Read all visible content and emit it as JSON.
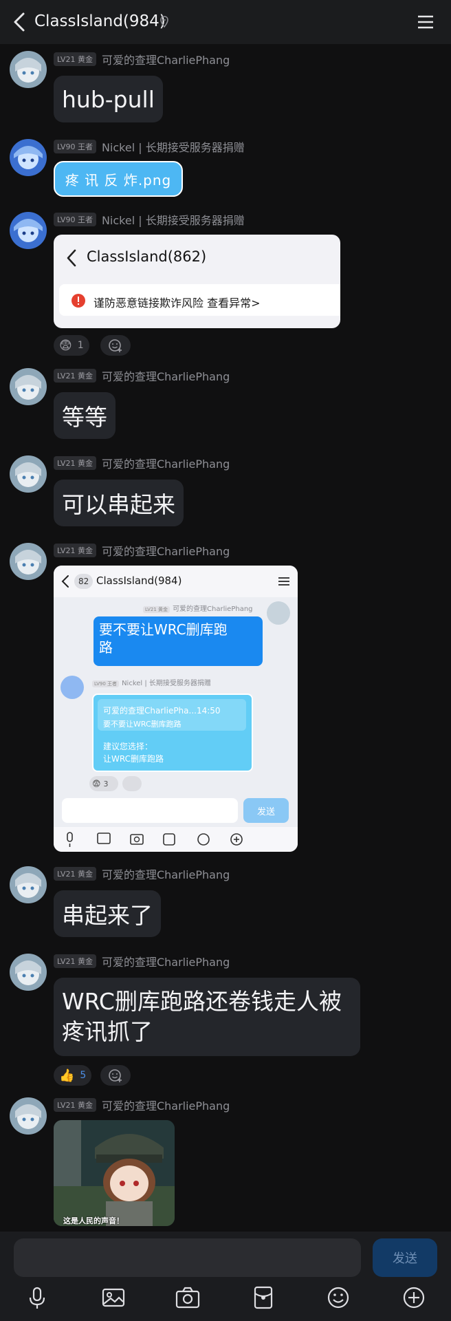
{
  "header": {
    "title": "ClassIsland(984)",
    "back_icon": "back-arrow-icon",
    "pin_icon": "pin-icon",
    "menu_icon": "menu-icon"
  },
  "messages": [
    {
      "level": "LV21 黄金",
      "nick": "可爱的查理CharliePhang",
      "text": "hub-pull"
    },
    {
      "level": "LV90 王者",
      "nick": "Nickel | 长期接受服务器捐赠",
      "file": "疼 讯 反 炸.png"
    },
    {
      "level": "LV90 王者",
      "nick": "Nickel | 长期接受服务器捐赠",
      "card": {
        "title": "ClassIsland(862)",
        "warning": "谨防恶意链接欺诈风险 查看异常>"
      },
      "reaction": {
        "emoji": "😨",
        "count": "1"
      }
    },
    {
      "level": "LV21 黄金",
      "nick": "可爱的查理CharliePhang",
      "text": "等等"
    },
    {
      "level": "LV21 黄金",
      "nick": "可爱的查理CharliePhang",
      "text": "可以串起来"
    },
    {
      "level": "LV21 黄金",
      "nick": "可爱的查理CharliePhang",
      "shot": {
        "badge": "82",
        "title": "ClassIsland(984)",
        "lv1": "LV21 黄金",
        "nick1": "可爱的查理CharliePhang",
        "blue_line1": "要不要让WRC删库跑",
        "blue_line2": "路",
        "lv2": "LV90 王者",
        "nick2": "Nickel | 长期接受服务器捐赠",
        "quote_head": "可爱的查理CharliePha...14:50",
        "quote_body": "要不要让WRC删库跑路",
        "reply1": "建议您选择：",
        "reply2": "让WRC删库跑路",
        "react_count": "3",
        "send": "发送"
      }
    },
    {
      "level": "LV21 黄金",
      "nick": "可爱的查理CharliePhang",
      "text": "串起来了"
    },
    {
      "level": "LV21 黄金",
      "nick": "可爱的查理CharliePhang",
      "text_line1": "WRC删库跑路还卷钱走人被",
      "text_line2": "疼讯抓了",
      "reaction": {
        "emoji": "👍",
        "count": "5"
      }
    },
    {
      "level": "LV21 黄金",
      "nick": "可爱的查理CharliePhang",
      "sticker_caption": "这是人民的声音！"
    }
  ],
  "composer": {
    "send_label": "发送",
    "tools": [
      "microphone-icon",
      "image-icon",
      "camera-icon",
      "red-packet-icon",
      "emoji-icon",
      "plus-icon"
    ]
  },
  "colors": {
    "background": "#101011",
    "bubble": "#24262b",
    "accent_blue": "#4db7f3",
    "send_blue": "#123a66"
  }
}
